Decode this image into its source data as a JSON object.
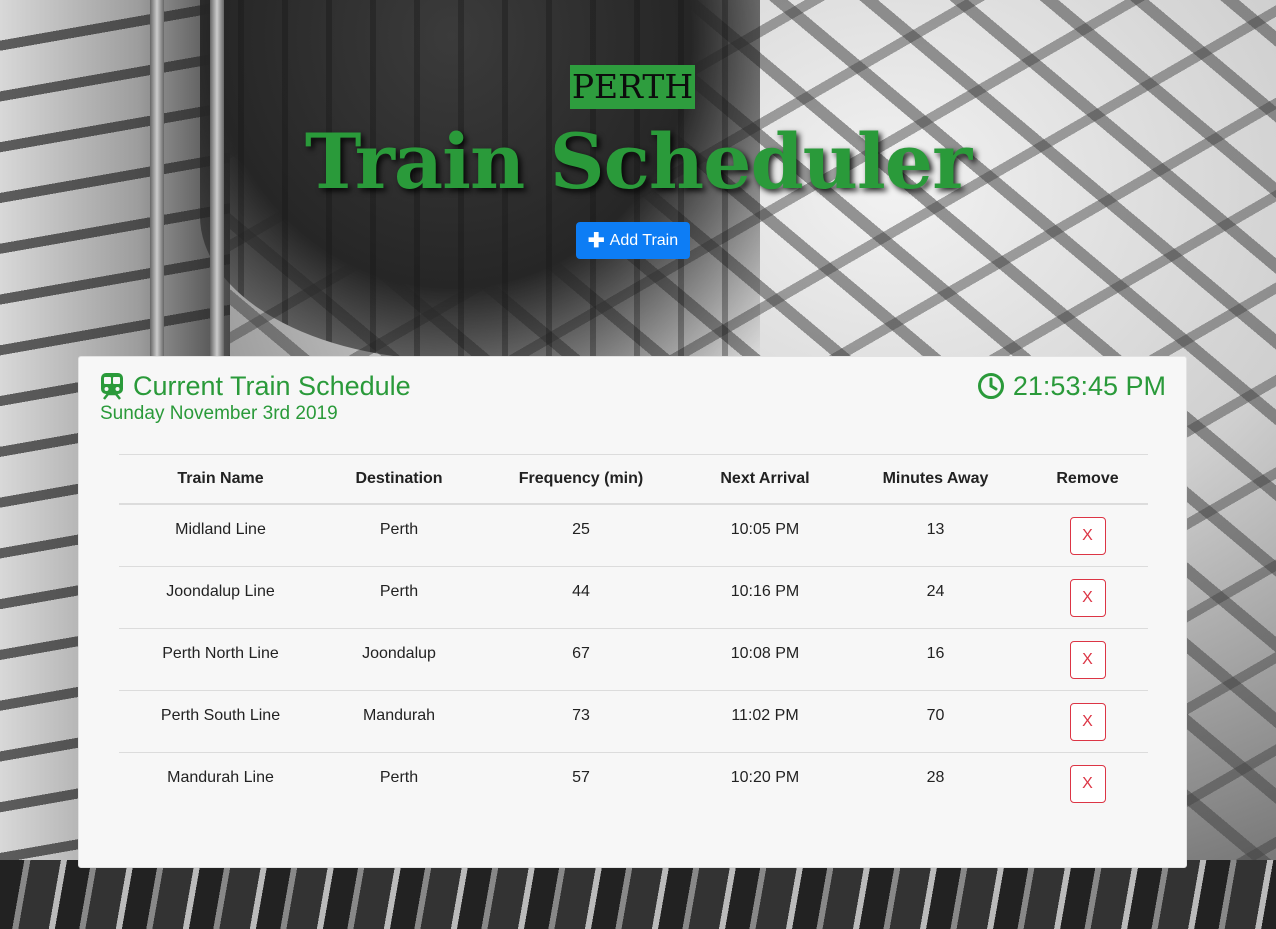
{
  "header": {
    "city": "PERTH",
    "title": "Train Scheduler",
    "add_button": {
      "label": "Add Train",
      "icon": "plus-icon",
      "color": "#0d7df5"
    }
  },
  "card": {
    "title": "Current Train Schedule",
    "title_icon": "train-icon",
    "date": "Sunday November 3rd 2019",
    "clock_icon": "clock-icon",
    "time": "21:53:45 PM",
    "accent_color": "#2a9a3a"
  },
  "table": {
    "columns": [
      "Train Name",
      "Destination",
      "Frequency (min)",
      "Next Arrival",
      "Minutes Away",
      "Remove"
    ],
    "remove_label": "X",
    "rows": [
      {
        "name": "Midland Line",
        "destination": "Perth",
        "frequency": "25",
        "next_arrival": "10:05 PM",
        "minutes_away": "13"
      },
      {
        "name": "Joondalup Line",
        "destination": "Perth",
        "frequency": "44",
        "next_arrival": "10:16 PM",
        "minutes_away": "24"
      },
      {
        "name": "Perth North Line",
        "destination": "Joondalup",
        "frequency": "67",
        "next_arrival": "10:08 PM",
        "minutes_away": "16"
      },
      {
        "name": "Perth South Line",
        "destination": "Mandurah",
        "frequency": "73",
        "next_arrival": "11:02 PM",
        "minutes_away": "70"
      },
      {
        "name": "Mandurah Line",
        "destination": "Perth",
        "frequency": "57",
        "next_arrival": "10:20 PM",
        "minutes_away": "28"
      }
    ]
  }
}
